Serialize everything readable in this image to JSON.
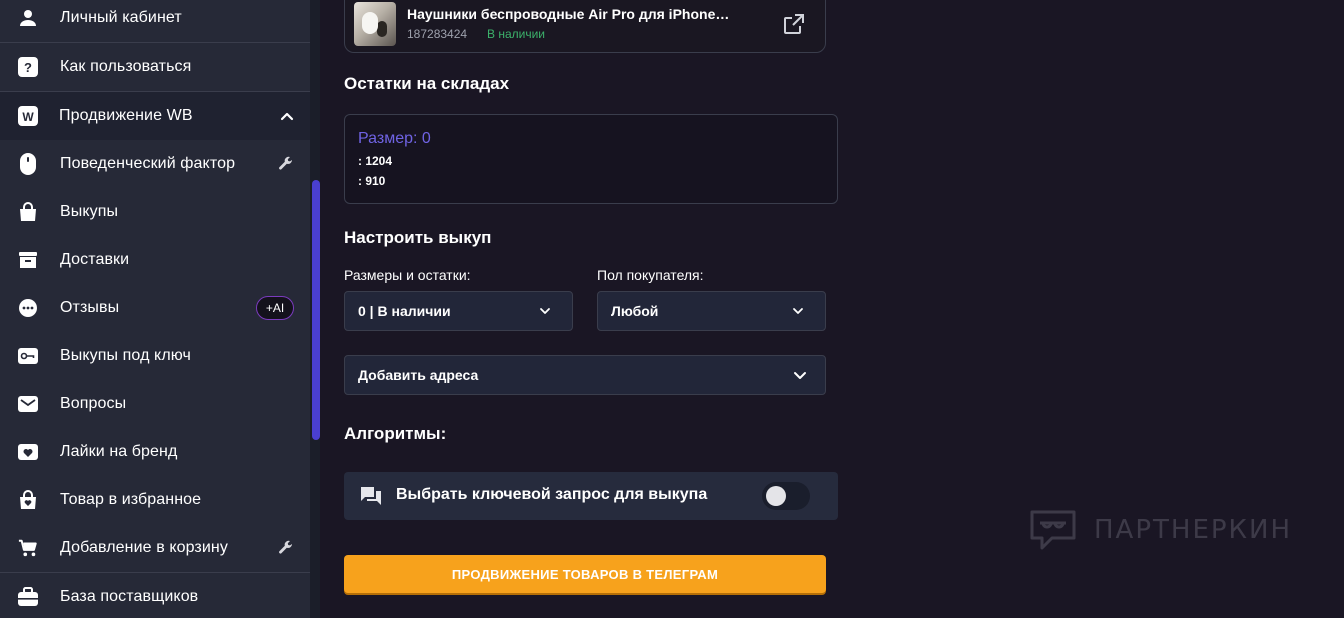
{
  "sidebar": {
    "items": [
      {
        "label": "Личный кабинет",
        "icon": "user-icon"
      },
      {
        "label": "Как пользоваться",
        "icon": "help-icon"
      },
      {
        "label": "Продвижение WB",
        "icon": "wb-logo-icon"
      },
      {
        "label": "Поведенческий фактор",
        "icon": "mouse-icon"
      },
      {
        "label": "Выкупы",
        "icon": "shopping-bag-icon"
      },
      {
        "label": "Доставки",
        "icon": "archive-box-icon"
      },
      {
        "label": "Отзывы",
        "icon": "chat-bubble-icon"
      },
      {
        "label": "Выкупы под ключ",
        "icon": "key-icon"
      },
      {
        "label": "Вопросы",
        "icon": "envelope-icon"
      },
      {
        "label": "Лайки на бренд",
        "icon": "heart-box-icon"
      },
      {
        "label": "Товар в избранное",
        "icon": "favorite-bag-icon"
      },
      {
        "label": "Добавление в корзину",
        "icon": "cart-icon"
      },
      {
        "label": "База поставщиков",
        "icon": "briefcase-icon"
      }
    ],
    "ai_badge": "+AI"
  },
  "product": {
    "title": "Наушники беспроводные Air Pro для iPhone…",
    "sku": "187283424",
    "stock_status": "В наличии"
  },
  "warehouse": {
    "heading": "Остатки на складах",
    "size_title": "Размер: 0",
    "lines": [
      ": 1204",
      ": 910"
    ]
  },
  "setup": {
    "heading": "Настроить выкуп",
    "sizes_label": "Размеры и остатки:",
    "sizes_value": "0 | В наличии",
    "gender_label": "Пол покупателя:",
    "gender_value": "Любой",
    "address_value": "Добавить адреса"
  },
  "algorithms": {
    "heading": "Алгоритмы:",
    "keyword_label": "Выбрать ключевой запрос для выкупа",
    "keyword_toggle_on": false
  },
  "cta_label": "ПРОДВИЖЕНИЕ ТОВАРОВ В ТЕЛЕГРАМ",
  "watermark": "ПАРТНЕРКИН",
  "colors": {
    "accent_orange": "#f7a21c",
    "accent_purple": "#6f63e3",
    "stock_green": "#3cb26b",
    "sidebar_bg": "#262937"
  }
}
